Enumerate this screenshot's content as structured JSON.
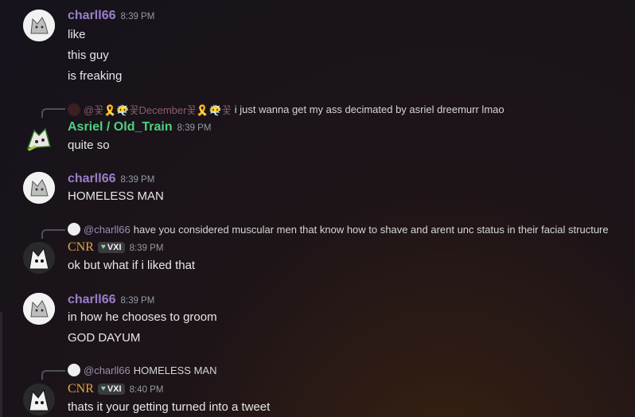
{
  "messages": [
    {
      "author": "charll66",
      "author_color": "#9a7fc9",
      "time": "8:39 PM",
      "lines": [
        "like",
        "this guy",
        "is freaking"
      ]
    },
    {
      "reply": {
        "mention": "@꽃🎗️😶‍🌫️꽃December꽃🎗️😶‍🌫️꽃",
        "text": "i just wanna get my ass decimated by asriel dreemurr lmao"
      },
      "author": "Asriel / Old_Train",
      "author_color": "#4fd07f",
      "time": "8:39 PM",
      "lines": [
        "quite so"
      ]
    },
    {
      "author": "charll66",
      "author_color": "#9a7fc9",
      "time": "8:39 PM",
      "lines": [
        "HOMELESS MAN"
      ]
    },
    {
      "reply": {
        "mention": "@charll66",
        "text": "have you considered muscular men that know how to shave and arent unc status in their facial structure"
      },
      "author": "CNR",
      "author_color": "#e3a64a",
      "tag": "VXI",
      "time": "8:39 PM",
      "lines": [
        "ok but what if i liked that"
      ]
    },
    {
      "author": "charll66",
      "author_color": "#9a7fc9",
      "time": "8:39 PM",
      "lines": [
        "in how he chooses to groom",
        "GOD DAYUM"
      ]
    },
    {
      "reply": {
        "mention": "@charll66",
        "text": "HOMELESS MAN"
      },
      "author": "CNR",
      "author_color": "#e3a64a",
      "tag": "VXI",
      "time": "8:40 PM",
      "lines": [
        "thats it your getting turned into a tweet"
      ]
    }
  ]
}
